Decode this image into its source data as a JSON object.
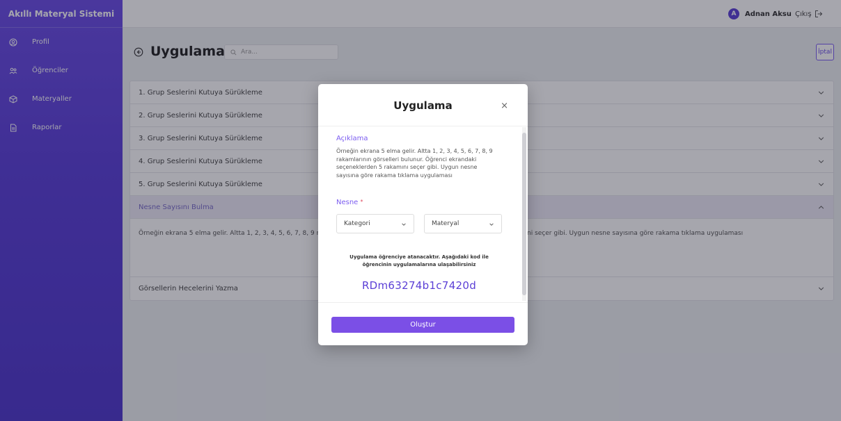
{
  "app": {
    "brand": "Akıllı Materyal Sistemi"
  },
  "sidebar": {
    "items": [
      {
        "label": "Profil",
        "icon": "user-circle-icon"
      },
      {
        "label": "Öğrenciler",
        "icon": "users-icon"
      },
      {
        "label": "Materyaller",
        "icon": "box-icon"
      },
      {
        "label": "Raporlar",
        "icon": "document-icon"
      }
    ]
  },
  "topbar": {
    "user_initial": "A",
    "user_name": "Adnan Aksu",
    "logout_label": "Çıkış"
  },
  "header": {
    "title": "Uygulama",
    "search_placeholder": "Ara...",
    "cancel_label": "İptal"
  },
  "list": {
    "rows": [
      {
        "label": "1. Grup Seslerini Kutuya Sürükleme"
      },
      {
        "label": "2. Grup Seslerini Kutuya Sürükleme"
      },
      {
        "label": "3. Grup Seslerini Kutuya Sürükleme"
      },
      {
        "label": "4. Grup Seslerini Kutuya Sürükleme"
      },
      {
        "label": "5. Grup Seslerini Kutuya Sürükleme"
      },
      {
        "label": "Nesne Sayısını Bulma"
      },
      {
        "label": "Görsellerin Hecelerini Yazma"
      }
    ],
    "expanded_text_left": "Örneğin ekrana 5 elma gelir. Altta 1, 2, 3, 4, 5, 6, 7, 8, 9 rakam",
    "expanded_text_right": "ni seçer gibi. Uygun nesne sayısına göre rakama tıklama uygulaması"
  },
  "modal": {
    "title": "Uygulama",
    "close": "×",
    "description_label": "Açıklama",
    "description": "Örneğin ekrana 5 elma gelir. Altta 1, 2, 3, 4, 5, 6, 7, 8, 9 rakamlarının görselleri bulunur. Öğrenci ekrandaki seçeneklerden 5 rakamını seçer gibi. Uygun nesne sayısına göre rakama tıklama uygulaması",
    "object_label": "Nesne",
    "required_mark": "*",
    "select_category": "Kategori",
    "select_material": "Materyal",
    "info_text": "Uygulama öğrenciye atanacaktır. Aşağıdaki kod ile öğrencinin uygulamalarına ulaşabilirsiniz",
    "code": "RDm63274b1c7420d",
    "create_label": "Oluştur"
  },
  "colors": {
    "accent": "#6b4de6",
    "accent_dark": "#4e37cc",
    "button": "#7b4fe6"
  }
}
